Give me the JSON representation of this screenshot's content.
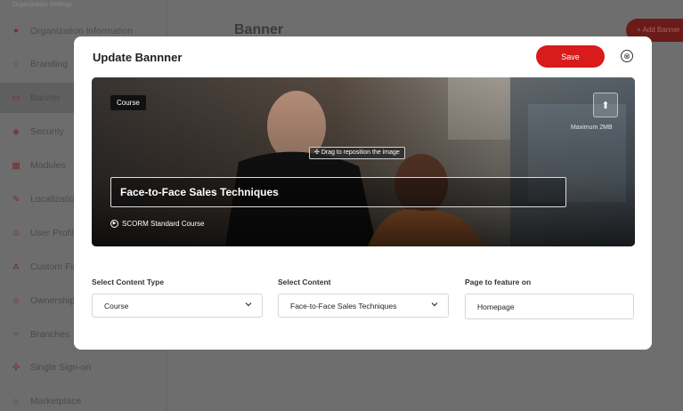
{
  "background": {
    "sidebar_heading": "Organization Settings",
    "sidebar_items": [
      {
        "label": "Organization Information",
        "icon": "building-icon"
      },
      {
        "label": "Branding",
        "icon": "star-icon"
      },
      {
        "label": "Banner",
        "icon": "image-icon"
      },
      {
        "label": "Security",
        "icon": "shield-icon"
      },
      {
        "label": "Modules",
        "icon": "grid-icon"
      },
      {
        "label": "Localization",
        "icon": "globe-icon"
      },
      {
        "label": "User Profile",
        "icon": "users-icon"
      },
      {
        "label": "Custom Fields",
        "icon": "text-icon"
      },
      {
        "label": "Ownership",
        "icon": "user-icon"
      },
      {
        "label": "Branches",
        "icon": "branch-icon"
      },
      {
        "label": "Single Sign-on",
        "icon": "key-icon"
      },
      {
        "label": "Marketplace",
        "icon": "store-icon"
      }
    ],
    "page_title": "Banner",
    "add_button": "+ Add Banner"
  },
  "modal": {
    "title": "Update Bannner",
    "save_label": "Save",
    "close_glyph": "⊗"
  },
  "banner": {
    "tag": "Course",
    "drag_hint": "Drag to reposition the image",
    "max_size": "Maximum 2MB",
    "title": "Face-to-Face Sales Techniques",
    "course_type": "SCORM Standard Course"
  },
  "form": {
    "content_type_label": "Select Content Type",
    "content_type_value": "Course",
    "content_label": "Select Content",
    "content_value": "Face-to-Face Sales Techniques",
    "page_label": "Page to feature on",
    "page_value": "Homepage"
  },
  "colors": {
    "accent": "#d81b1b",
    "overlay": "#6f6f6f"
  }
}
